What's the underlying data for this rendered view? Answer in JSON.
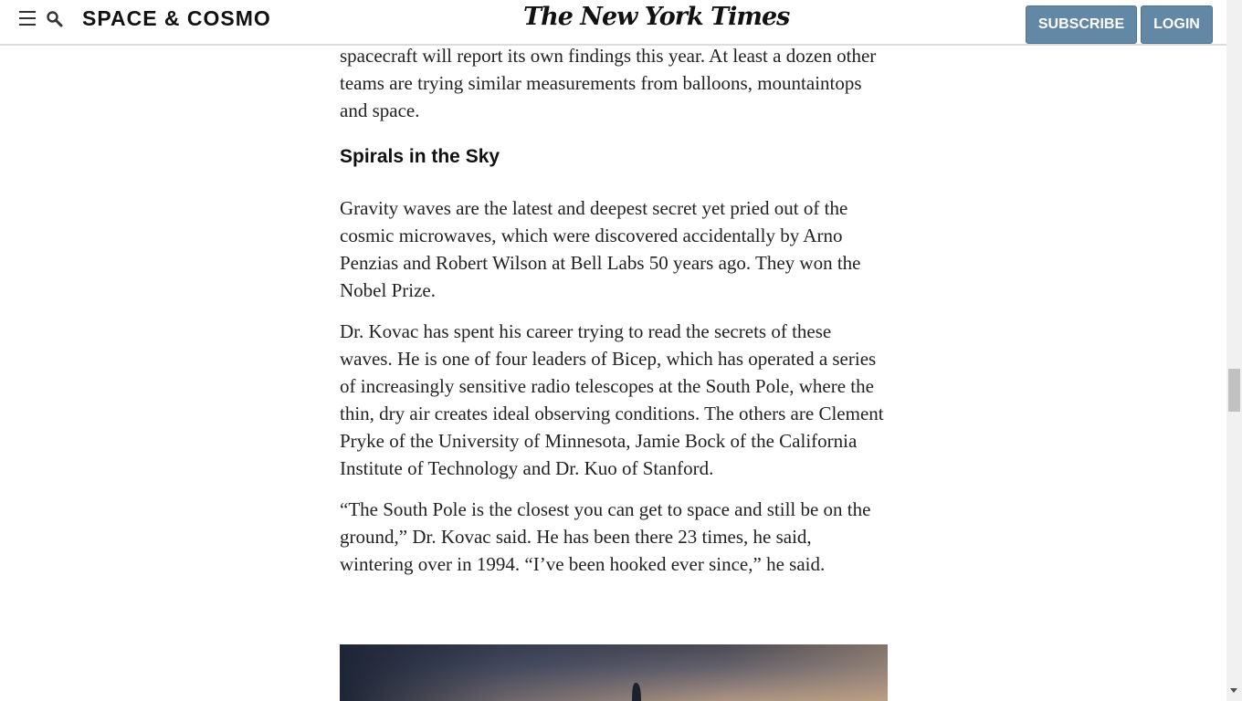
{
  "header": {
    "section_title": "SPACE & COSMO",
    "logo": "The New York Times",
    "subscribe_label": "SUBSCRIBE",
    "login_label": "LOGIN"
  },
  "article": {
    "paragraphs_top": [
      "spacecraft will report its own findings this year. At least a dozen other teams are trying similar measurements from balloons, mountaintops and space."
    ],
    "subhead": "Spirals in the Sky",
    "paragraphs": [
      "Gravity waves are the latest and deepest secret yet pried out of the cosmic microwaves, which were discovered accidentally by Arno Penzias and Robert Wilson at Bell Labs 50 years ago. They won the Nobel Prize.",
      "Dr. Kovac has spent his career trying to read the secrets of these waves. He is one of four leaders of Bicep, which has operated a series of increasingly sensitive radio telescopes at the South Pole, where the thin, dry air creates ideal observing conditions. The others are Clement Pryke of the University of Minnesota, Jamie Bock of the California Institute of Technology and Dr. Kuo of Stanford.",
      "“The South Pole is the closest you can get to space and still be on the ground,” Dr. Kovac said. He has been there 23 times, he said, wintering over in 1994. “I’ve been hooked ever since,” he said."
    ]
  },
  "icons": {
    "menu": "hamburger-menu-icon",
    "search": "search-icon"
  },
  "colors": {
    "button_bg": "#6288a5",
    "header_border": "#dcdcdc"
  }
}
